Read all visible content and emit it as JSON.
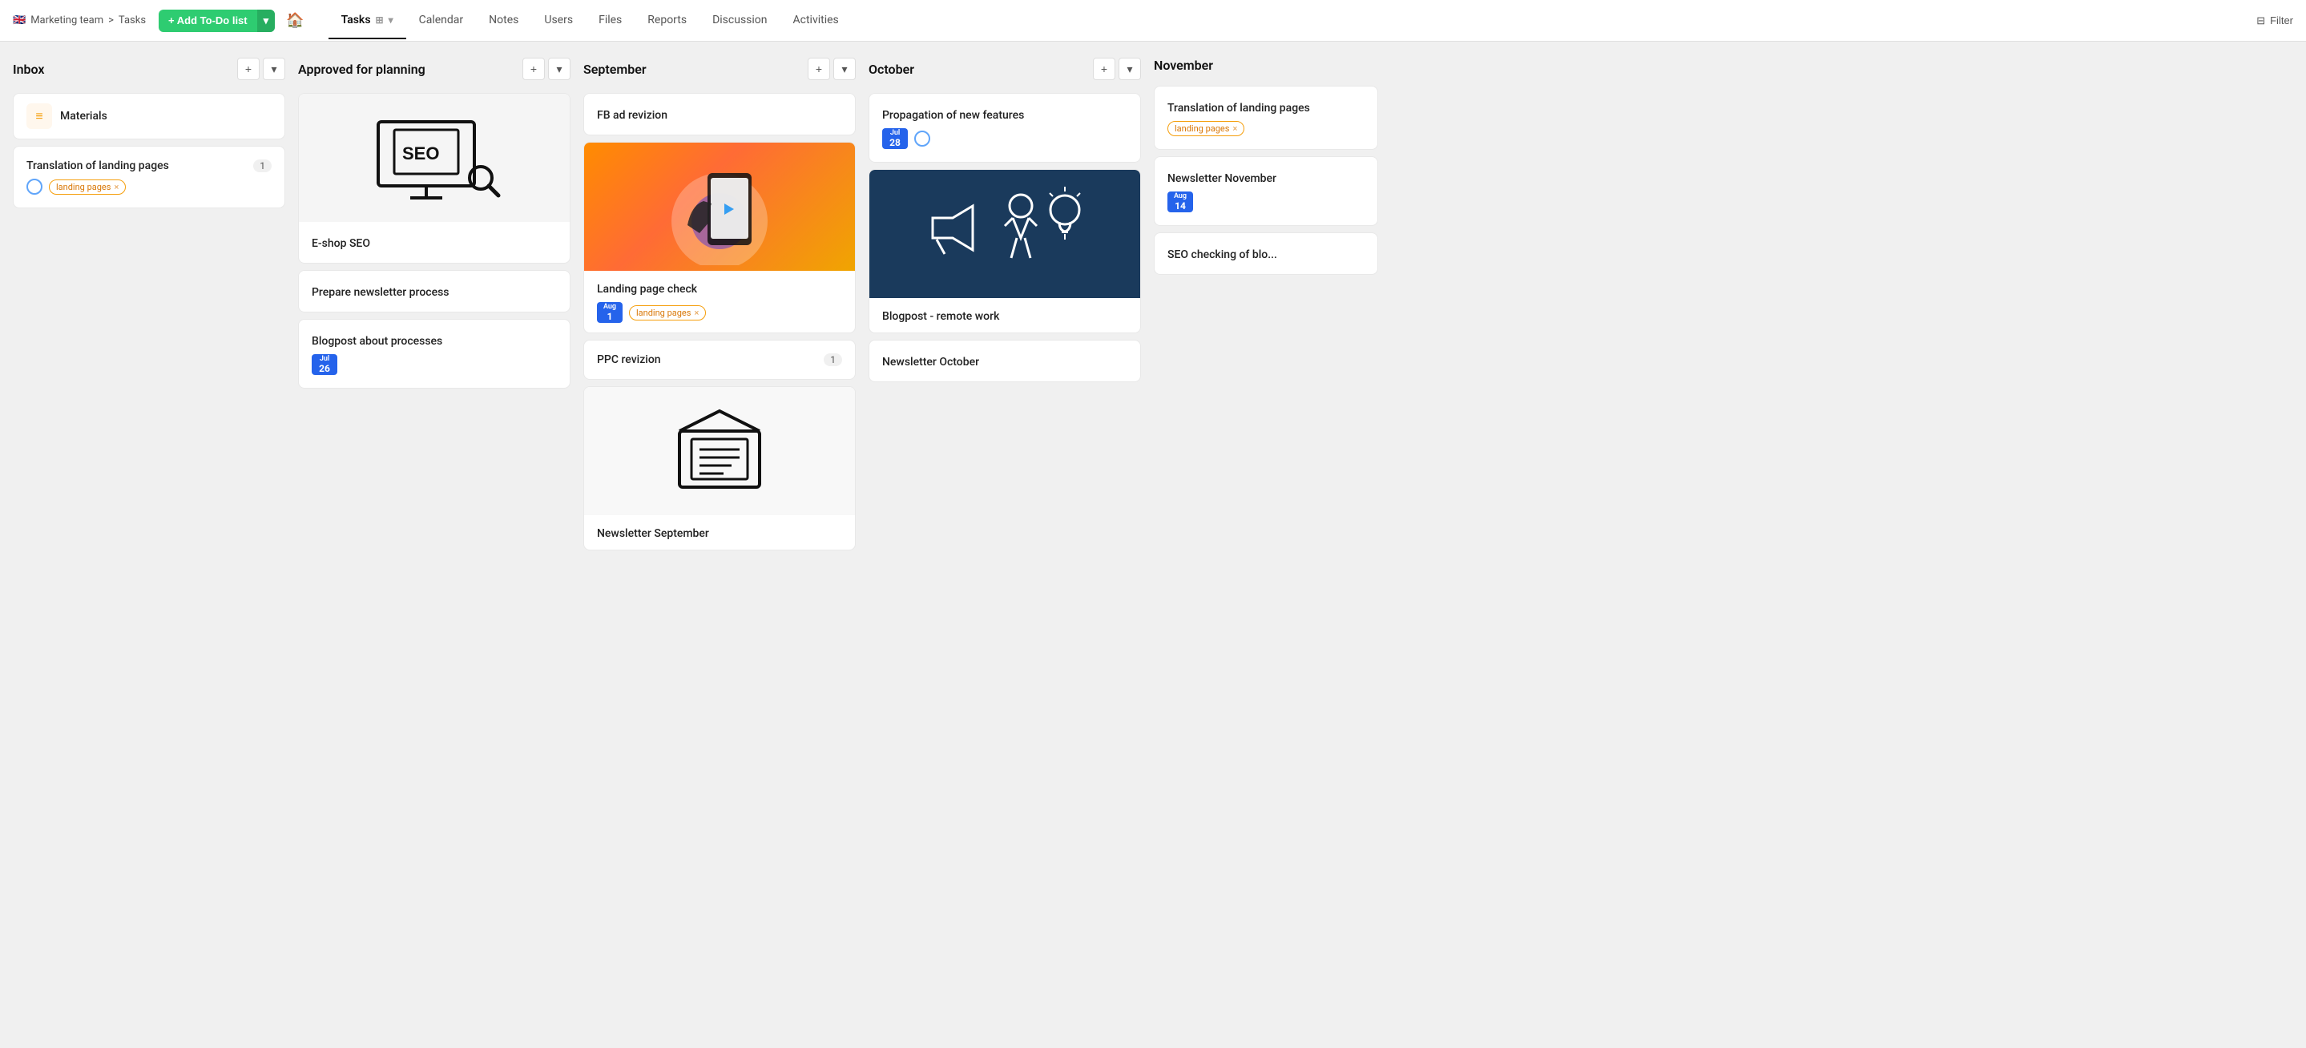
{
  "breadcrumb": {
    "flag": "🇬🇧",
    "team": "Marketing team",
    "sep": ">",
    "page": "Tasks"
  },
  "toolbar": {
    "add_label": "+ Add To-Do list",
    "home_icon": "🏠",
    "filter_label": "Filter"
  },
  "nav": {
    "tabs": [
      {
        "id": "tasks",
        "label": "Tasks",
        "active": true
      },
      {
        "id": "calendar",
        "label": "Calendar"
      },
      {
        "id": "notes",
        "label": "Notes"
      },
      {
        "id": "users",
        "label": "Users"
      },
      {
        "id": "files",
        "label": "Files"
      },
      {
        "id": "reports",
        "label": "Reports"
      },
      {
        "id": "discussion",
        "label": "Discussion"
      },
      {
        "id": "activities",
        "label": "Activities"
      }
    ]
  },
  "columns": [
    {
      "id": "inbox",
      "title": "Inbox",
      "cards": [
        {
          "id": "materials",
          "type": "materials",
          "title": "Materials",
          "icon": "≡"
        },
        {
          "id": "translation",
          "type": "regular",
          "title": "Translation of landing pages",
          "count": "1",
          "has_circle": true,
          "tag": "landing pages"
        }
      ]
    },
    {
      "id": "approved",
      "title": "Approved for planning",
      "cards": [
        {
          "id": "eshop-seo",
          "type": "seo-image",
          "title": "E-shop SEO"
        },
        {
          "id": "newsletter-process",
          "type": "regular",
          "title": "Prepare newsletter process"
        },
        {
          "id": "blogpost-processes",
          "type": "regular",
          "title": "Blogpost about processes",
          "date_month": "Jul",
          "date_day": "26"
        }
      ]
    },
    {
      "id": "september",
      "title": "September",
      "cards": [
        {
          "id": "fb-ad",
          "type": "regular",
          "title": "FB ad revizion"
        },
        {
          "id": "landing-check",
          "type": "landing-image",
          "title": "Landing page check",
          "date_month": "Aug",
          "date_day": "1",
          "tag": "landing pages"
        },
        {
          "id": "ppc",
          "type": "regular",
          "title": "PPC revizion",
          "count": "1"
        },
        {
          "id": "newsletter-sep",
          "type": "envelope-image",
          "title": "Newsletter September"
        }
      ]
    },
    {
      "id": "october",
      "title": "October",
      "cards": [
        {
          "id": "propagation",
          "type": "regular",
          "title": "Propagation of new features",
          "date_month": "Jul",
          "date_day": "28",
          "has_circle": true
        },
        {
          "id": "newsletter-bg",
          "type": "newsletter-image",
          "title": "Blogpost - remote work"
        },
        {
          "id": "newsletter-oct",
          "type": "regular",
          "title": "Newsletter October"
        }
      ]
    },
    {
      "id": "november",
      "title": "November",
      "cards": [
        {
          "id": "translation-landing",
          "type": "regular",
          "title": "Translation of landing pages",
          "tag": "landing pages"
        },
        {
          "id": "newsletter-nov",
          "type": "regular",
          "title": "Newsletter November",
          "date_month": "Aug",
          "date_day": "14"
        },
        {
          "id": "seo-blog",
          "type": "regular",
          "title": "SEO checking of blo..."
        }
      ]
    }
  ],
  "labels": {
    "landing_pages": "landing pages",
    "add_col": "+",
    "chevron": "▾",
    "jul": "Jul",
    "aug": "Aug"
  }
}
